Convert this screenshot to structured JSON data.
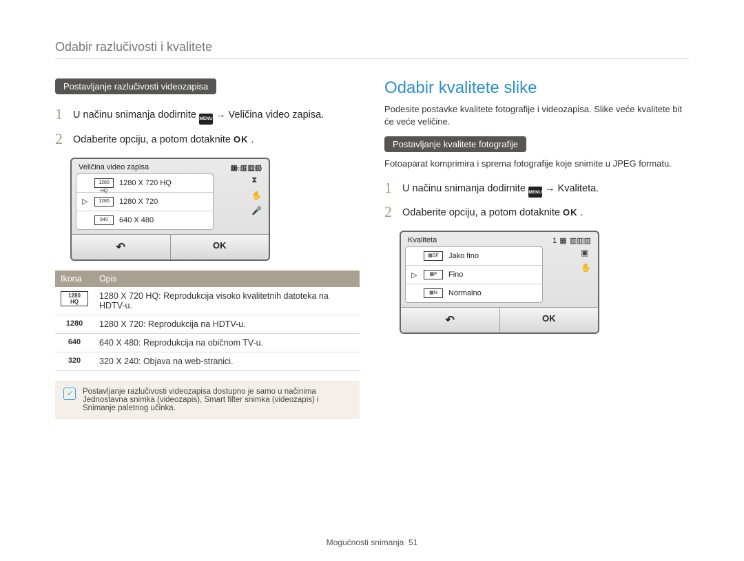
{
  "header": "Odabir razlučivosti i kvalitete",
  "left": {
    "tag": "Postavljanje razlučivosti videozapisa",
    "step1_pre": "U načinu snimanja dodirnite ",
    "step1_post": " → Veličina video zapisa.",
    "step2_pre": "Odaberite opciju, a potom dotaknite ",
    "ok": "OK",
    "mock": {
      "title": "Veličina video zapisa",
      "top_right": "00:05  1280",
      "rows": [
        {
          "icon": "1280 HQ",
          "label": "1280 X 720 HQ",
          "sel": false
        },
        {
          "icon": "1280",
          "label": "1280 X 720",
          "sel": true
        },
        {
          "icon": "640",
          "label": "640 X 480",
          "sel": false
        }
      ],
      "back": "↶",
      "ok": "OK"
    },
    "table": {
      "h1": "Ikona",
      "h2": "Opis",
      "rows": [
        {
          "icon": "1280 HQ",
          "desc": "1280 X 720 HQ: Reprodukcija visoko kvalitetnih datoteka na HDTV-u."
        },
        {
          "icon": "1280",
          "desc": "1280 X 720: Reprodukcija na HDTV-u."
        },
        {
          "icon": "640",
          "desc": "640 X 480: Reprodukcija na običnom TV-u."
        },
        {
          "icon": "320",
          "desc": "320 X 240: Objava na web-stranici."
        }
      ]
    },
    "note": "Postavljanje razlučivosti videozapisa dostupno je samo u načinima Jednostavna snimka (videozapis), Smart ﬁlter snimka (videozapis) i Snimanje paletnog učinka."
  },
  "right": {
    "title": "Odabir kvalitete slike",
    "intro": "Podesite postavke kvalitete fotograﬁje i videozapisa. Slike veće kvalitete bit će veće veličine.",
    "tag": "Postavljanje kvalitete fotograﬁje",
    "sub": "Fotoaparat komprimira i sprema fotograﬁje koje snimite u JPEG formatu.",
    "step1_pre": "U načinu snimanja dodirnite ",
    "step1_post": " → Kvaliteta.",
    "step2_pre": "Odaberite opciju, a potom dotaknite ",
    "ok": "OK",
    "mock": {
      "title": "Kvaliteta",
      "top_right": "1",
      "rows": [
        {
          "label": "Jako ﬁno",
          "sel": false
        },
        {
          "label": "Fino",
          "sel": true
        },
        {
          "label": "Normalno",
          "sel": false
        }
      ],
      "back": "↶",
      "ok": "OK"
    }
  },
  "footer_text": "Mogućnosti snimanja",
  "footer_page": "51",
  "menu_label": "MENU"
}
